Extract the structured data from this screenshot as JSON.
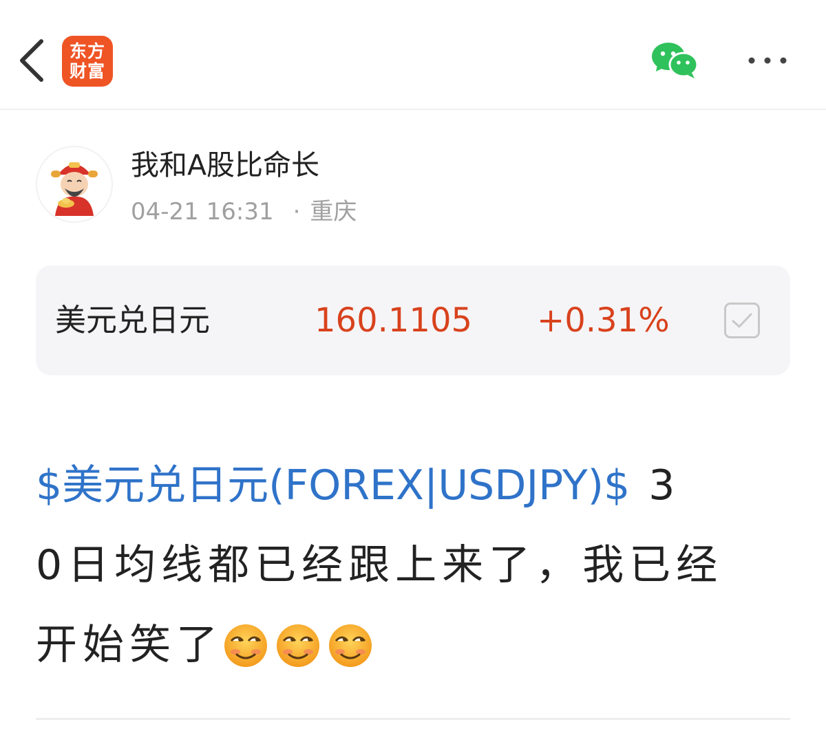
{
  "header": {
    "logo_line1": "东方",
    "logo_line2": "财富",
    "back_icon": "chevron-left-icon",
    "share_icon": "wechat-icon",
    "more_icon": "more-horizontal-icon"
  },
  "author": {
    "name": "我和A股比命长",
    "timestamp": "04-21 16:31",
    "separator": "·",
    "location": "重庆",
    "avatar_icon": "caishen-avatar"
  },
  "quote": {
    "name": "美元兑日元",
    "price": "160.1105",
    "change": "+0.31%",
    "price_color": "#d8421d",
    "checkbox_icon": "checkbox-checked-icon"
  },
  "post": {
    "stock_link": "$美元兑日元(FOREX|USDJPY)$",
    "line1_rest": " 3",
    "line2": "0日均线都已经跟上来了，我已经",
    "line3": "开始笑了",
    "emoji_icon": "smirk-emoji-icon",
    "link_color": "#2f73c9"
  },
  "colors": {
    "brand": "#ef5425",
    "up": "#d8421d",
    "link": "#2f73c9"
  }
}
